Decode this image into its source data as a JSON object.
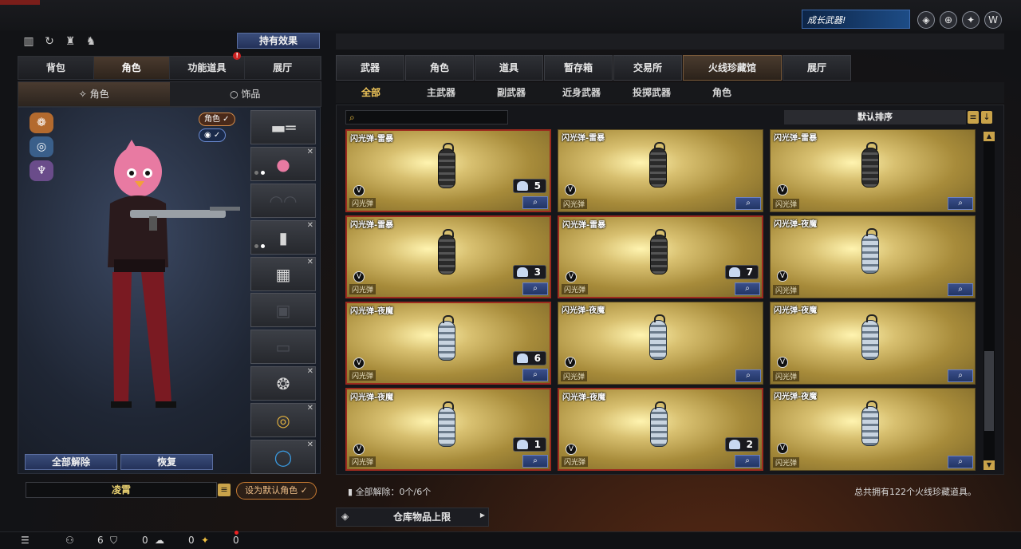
{
  "top": {
    "promo_text": "成长武器!"
  },
  "left": {
    "hold_effect_label": "持有效果",
    "tabs": [
      {
        "label": "背包"
      },
      {
        "label": "角色"
      },
      {
        "label": "功能道具"
      },
      {
        "label": "展厅"
      }
    ],
    "subtabs": [
      {
        "label": "角色"
      },
      {
        "label": "饰品"
      }
    ],
    "badge_role": "角色 ✓",
    "badge_eye": "◉ ✓",
    "btn_unequip_all": "全部解除",
    "btn_restore": "恢复",
    "char_name": "凌霄",
    "btn_set_default": "设为默认角色 ✓"
  },
  "right": {
    "tabs": [
      {
        "label": "武器"
      },
      {
        "label": "角色"
      },
      {
        "label": "道具"
      },
      {
        "label": "暂存箱"
      },
      {
        "label": "交易所"
      },
      {
        "label": "火线珍藏馆"
      },
      {
        "label": "展厅"
      }
    ],
    "subtabs": [
      {
        "label": "全部"
      },
      {
        "label": "主武器"
      },
      {
        "label": "副武器"
      },
      {
        "label": "近身武器"
      },
      {
        "label": "投掷武器"
      },
      {
        "label": "角色"
      }
    ],
    "sort_label": "默认排序",
    "items": [
      {
        "title": "闪光弹-雷暴",
        "kind": "闪光弹",
        "qty": "5",
        "variant": "dark",
        "frame": "red"
      },
      {
        "title": "闪光弹-雷暴",
        "kind": "闪光弹",
        "qty": "",
        "variant": "dark",
        "frame": "plain"
      },
      {
        "title": "闪光弹-雷暴",
        "kind": "闪光弹",
        "qty": "",
        "variant": "dark",
        "frame": "plain"
      },
      {
        "title": "闪光弹-雷暴",
        "kind": "闪光弹",
        "qty": "3",
        "variant": "dark",
        "frame": "red"
      },
      {
        "title": "闪光弹-雷暴",
        "kind": "闪光弹",
        "qty": "7",
        "variant": "dark",
        "frame": "red"
      },
      {
        "title": "闪光弹-夜魔",
        "kind": "闪光弹",
        "qty": "",
        "variant": "white",
        "frame": "plain"
      },
      {
        "title": "闪光弹-夜魔",
        "kind": "闪光弹",
        "qty": "6",
        "variant": "white",
        "frame": "red"
      },
      {
        "title": "闪光弹-夜魔",
        "kind": "闪光弹",
        "qty": "",
        "variant": "white",
        "frame": "plain"
      },
      {
        "title": "闪光弹-夜魔",
        "kind": "闪光弹",
        "qty": "",
        "variant": "white",
        "frame": "plain"
      },
      {
        "title": "闪光弹-夜魔",
        "kind": "闪光弹",
        "qty": "1",
        "variant": "white",
        "frame": "red"
      },
      {
        "title": "闪光弹-夜魔",
        "kind": "闪光弹",
        "qty": "2",
        "variant": "white",
        "frame": "red"
      },
      {
        "title": "闪光弹-夜魔",
        "kind": "闪光弹",
        "qty": "",
        "variant": "white",
        "frame": "plain"
      }
    ],
    "footer_unequip": "全部解除：0个/6个",
    "footer_total": "总共拥有122个火线珍藏道具。",
    "warehouse_label": "仓库物品上限"
  },
  "status": {
    "count_a": "6",
    "count_b": "0",
    "count_c": "0",
    "count_d": "0"
  }
}
